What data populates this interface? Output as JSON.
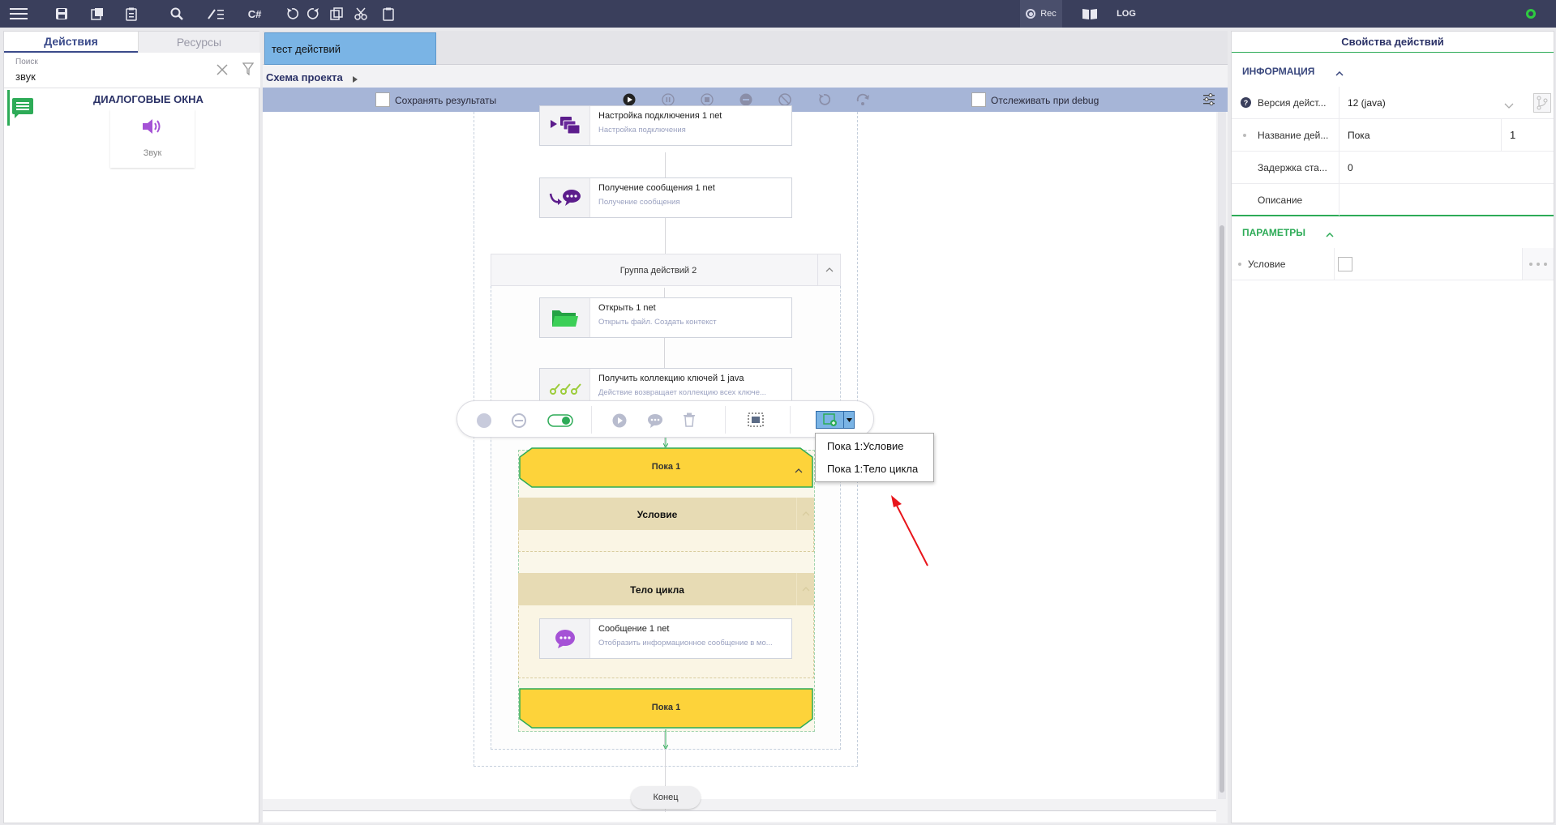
{
  "toolbar": {
    "rec_label": "Rec",
    "log_label": "LOG",
    "csharp_label": "C#",
    "status_color": "#2ecc40"
  },
  "left_panel": {
    "tabs": [
      "Действия",
      "Ресурсы"
    ],
    "search": {
      "label": "Поиск",
      "value": "звук"
    },
    "category": "ДИАЛОГОВЫЕ ОКНА",
    "items": [
      {
        "label": "Звук",
        "icon": "speaker-icon"
      }
    ]
  },
  "document_tab": "тест действий",
  "breadcrumb": "Схема проекта",
  "run_bar": {
    "save_results_label": "Сохранять результаты",
    "debug_label": "Отслеживать при debug"
  },
  "flow": {
    "cards": [
      {
        "title": "Настройка подключения  1  net",
        "subtitle": "Настройка подключения",
        "icon": "connection-icon"
      },
      {
        "title": "Получение сообщения  1  net",
        "subtitle": "Получение сообщения",
        "icon": "message-receive-icon"
      },
      {
        "title": "Открыть  1  net",
        "subtitle": "Открыть файл. Создать контекст",
        "icon": "folder-icon"
      },
      {
        "title": "Получить коллекцию ключей  1  java",
        "subtitle": "Действие возвращает коллекцию всех ключе...",
        "icon": "keys-icon"
      },
      {
        "title": "Сообщение  1  net",
        "subtitle": "Отобразить информационное сообщение в мо...",
        "icon": "chat-icon"
      }
    ],
    "group_title": "Группа действий  2",
    "while_top": "Пока  1",
    "condition_label": "Условие",
    "body_label": "Тело цикла",
    "while_bottom": "Пока  1",
    "end_label": "Конец"
  },
  "dropdown": {
    "items": [
      "Пока 1:Условие",
      "Пока 1:Тело цикла"
    ]
  },
  "properties": {
    "title": "Свойства действий",
    "info_section": "ИНФОРМАЦИЯ",
    "rows": [
      {
        "label": "Версия дейст...",
        "value": "12 (java)"
      },
      {
        "label": "Название дей...",
        "value": "Пока",
        "extra": "1"
      },
      {
        "label": "Задержка ста...",
        "value": "0"
      },
      {
        "label": "Описание",
        "value": ""
      }
    ],
    "params_section": "ПАРАМЕТРЫ",
    "params": [
      {
        "label": "Условие",
        "value": ""
      }
    ]
  },
  "colors": {
    "topbar": "#3a3f5c",
    "while_block": "#fdd33a",
    "accent_green": "#2dab57",
    "section_blue": "#39477d"
  }
}
